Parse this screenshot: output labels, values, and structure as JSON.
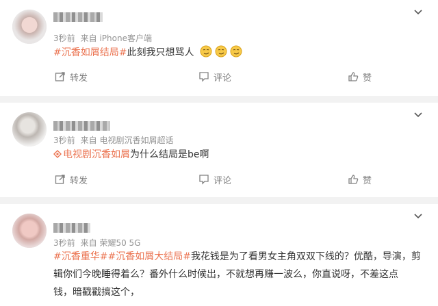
{
  "posts": [
    {
      "username": "用户",
      "time": "3秒前",
      "source": "来自 iPhone客户端",
      "tag": "#沉香如屑结局#",
      "text": "此刻我只想骂人",
      "emoji_icon": "smirk-emoji-icon",
      "actions": {
        "repost": "转发",
        "comment": "评论",
        "like": "赞"
      }
    },
    {
      "username": "用户",
      "time": "3秒前",
      "source": "来自 电视剧沉香如屑超话",
      "tag": "电视剧沉香如屑",
      "text": "为什么结局是be啊",
      "actions": {
        "repost": "转发",
        "comment": "评论",
        "like": "赞"
      }
    },
    {
      "username": "用户",
      "time": "3秒前",
      "source": "来自 荣耀50 5G",
      "tag1": "#沉香重华#",
      "tag2": "#沉香如屑大结局#",
      "line1": "我花钱是为了看男女主角双双下线的？优酷，导演，剪",
      "line2": "辑你们今晚睡得着么？番外什么时候出，不就想再赚一波么，你直说呀，不差这点",
      "line3": "钱，暗戳戳搞这个，"
    }
  ],
  "colors": {
    "topic": "#eb7350",
    "meta": "#939393",
    "action": "#808080"
  }
}
